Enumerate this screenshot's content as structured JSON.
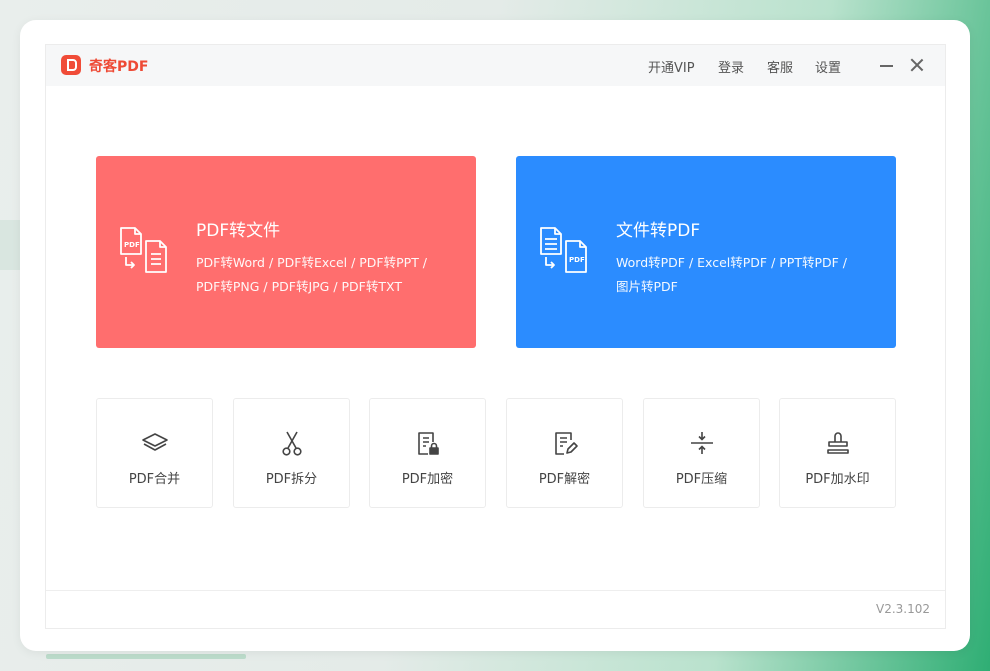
{
  "app": {
    "logo_text": "奇客PDF",
    "version": "V2.3.102"
  },
  "top_menu": {
    "vip": "开通VIP",
    "login": "登录",
    "service": "客服",
    "settings": "设置"
  },
  "cards": [
    {
      "title": "PDF转文件",
      "line1": "PDF转Word / PDF转Excel / PDF转PPT /",
      "line2": "PDF转PNG / PDF转JPG / PDF转TXT",
      "color": "#ff6e6e",
      "icon": "pdf-to-file-icon"
    },
    {
      "title": "文件转PDF",
      "line1": "Word转PDF / Excel转PDF / PPT转PDF /",
      "line2": "图片转PDF",
      "color": "#2b8cff",
      "icon": "file-to-pdf-icon"
    }
  ],
  "tools": [
    {
      "label": "PDF合并",
      "icon": "layers-icon"
    },
    {
      "label": "PDF拆分",
      "icon": "scissors-icon"
    },
    {
      "label": "PDF加密",
      "icon": "lock-document-icon"
    },
    {
      "label": "PDF解密",
      "icon": "edit-document-icon"
    },
    {
      "label": "PDF压缩",
      "icon": "compress-icon"
    },
    {
      "label": "PDF加水印",
      "icon": "stamp-icon"
    }
  ],
  "colors": {
    "brand": "#ee4a35",
    "red_card": "#ff6e6e",
    "blue_card": "#2b8cff"
  }
}
